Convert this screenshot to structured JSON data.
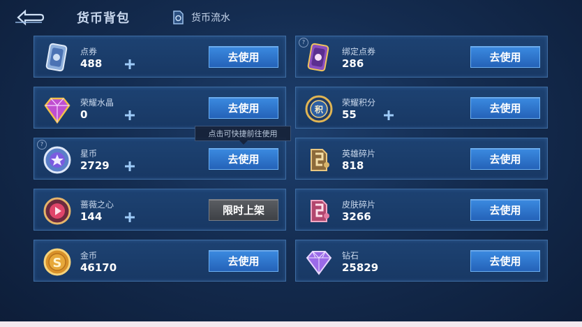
{
  "header": {
    "title": "货币背包",
    "flow_label": "货币流水"
  },
  "tooltip": "点击可快捷前往使用",
  "colors": {
    "accent_button": "#2f78d0",
    "card_bg": "#1b3d6b",
    "disabled_button": "#4a4d52"
  },
  "left_cards": [
    {
      "name": "点券",
      "amount": "488",
      "button": "去使用",
      "icon": "voucher-card-icon"
    },
    {
      "name": "荣耀水晶",
      "amount": "0",
      "button": "去使用",
      "icon": "glory-crystal-icon"
    },
    {
      "name": "星币",
      "amount": "2729",
      "button": "去使用",
      "icon": "star-coin-icon"
    },
    {
      "name": "蔷薇之心",
      "amount": "144",
      "button": "限时上架",
      "icon": "rose-heart-icon"
    },
    {
      "name": "金币",
      "amount": "46170",
      "button": "去使用",
      "icon": "gold-coin-icon"
    }
  ],
  "right_cards": [
    {
      "name": "绑定点券",
      "amount": "286",
      "button": "去使用",
      "icon": "bound-voucher-icon"
    },
    {
      "name": "荣耀积分",
      "amount": "55",
      "button": "去使用",
      "icon": "glory-points-icon"
    },
    {
      "name": "英雄碎片",
      "amount": "818",
      "button": "去使用",
      "icon": "hero-fragment-icon"
    },
    {
      "name": "皮肤碎片",
      "amount": "3266",
      "button": "去使用",
      "icon": "skin-fragment-icon"
    },
    {
      "name": "钻石",
      "amount": "25829",
      "button": "去使用",
      "icon": "diamond-icon"
    }
  ]
}
